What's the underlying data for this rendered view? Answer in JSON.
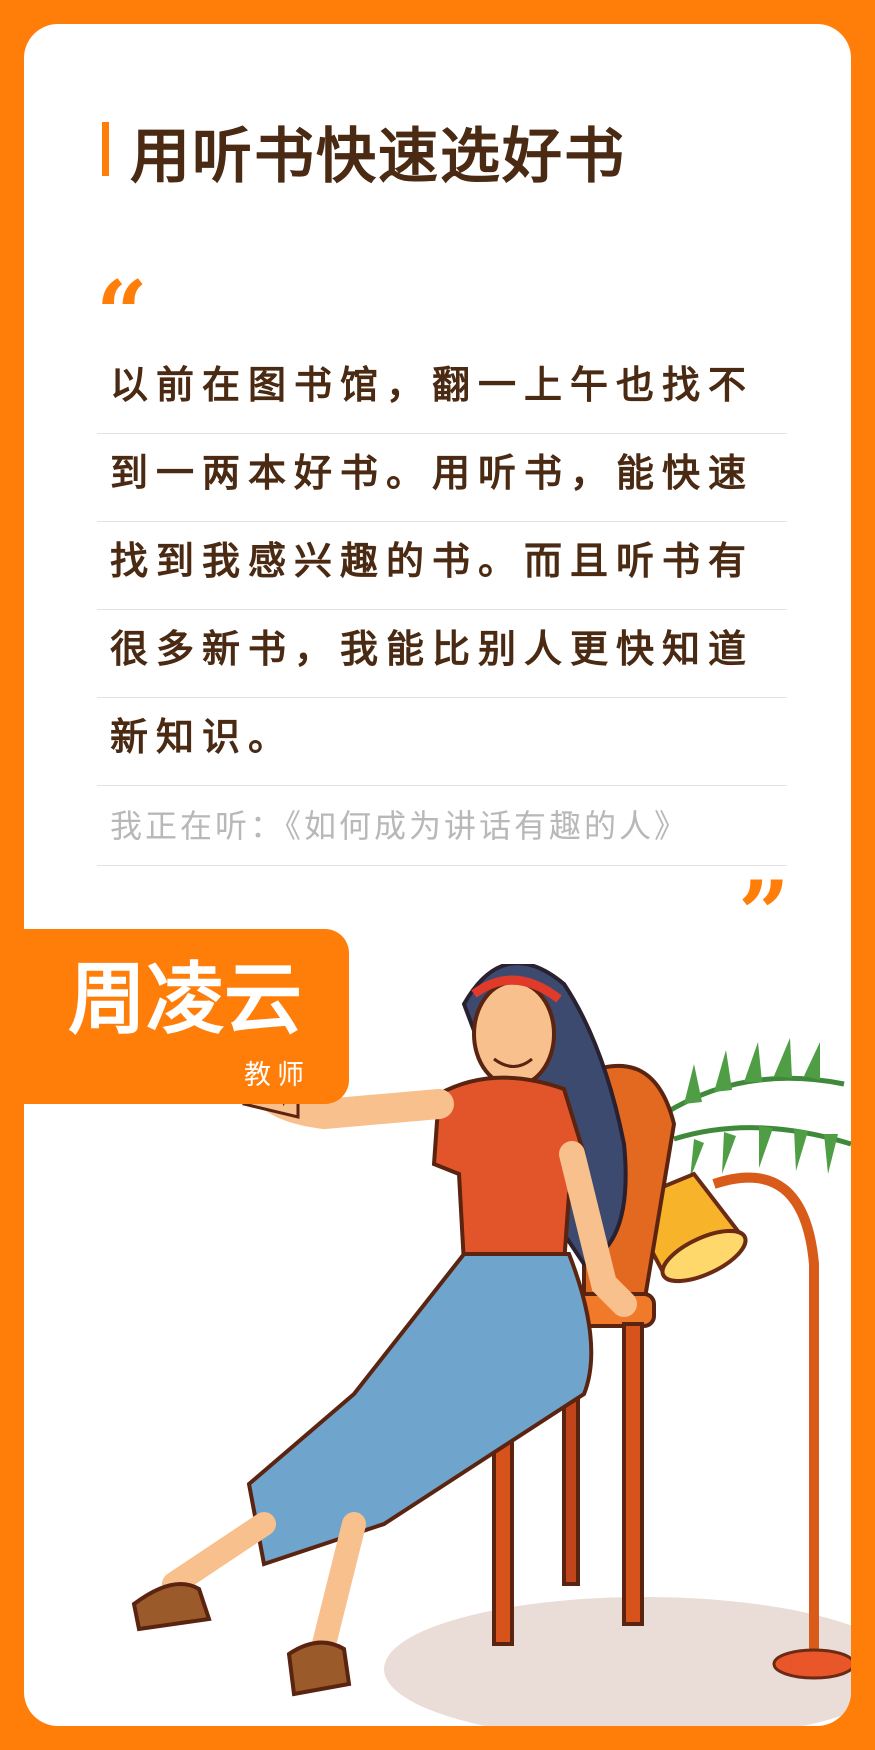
{
  "title": "用听书快速选好书",
  "quote_open": "“",
  "quote_close": "”",
  "quote_lines": [
    "以前在图书馆，翻一上午也找不",
    "到一两本好书。用听书，能快速",
    "找到我感兴趣的书。而且听书有",
    "很多新书，我能比别人更快知道",
    "新知识。"
  ],
  "listening": "我正在听：《如何成为讲话有趣的人》",
  "person": {
    "name": "周凌云",
    "role": "教师"
  },
  "colors": {
    "accent": "#ff7e0a",
    "text": "#4a2a12",
    "muted": "#b8b8b8"
  },
  "illustration": "woman-on-chair-illustration"
}
